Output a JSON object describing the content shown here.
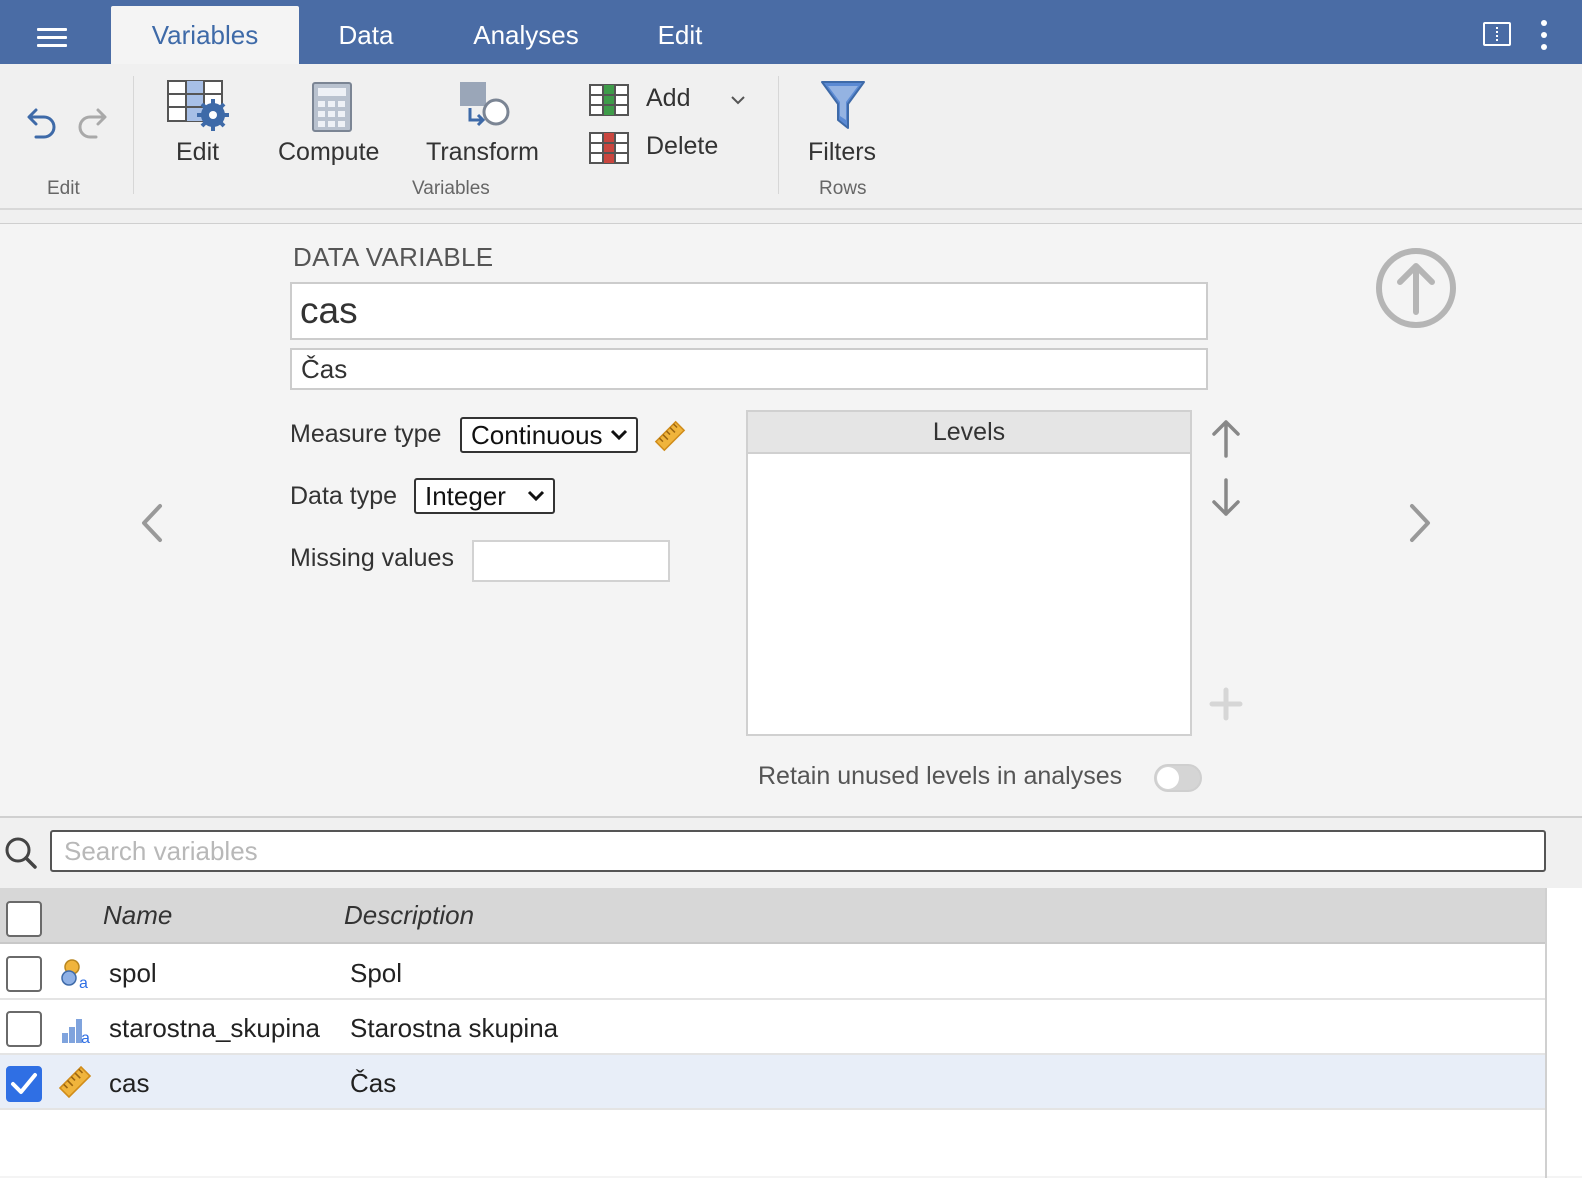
{
  "tabs": [
    "Variables",
    "Data",
    "Analyses",
    "Edit"
  ],
  "active_tab": "Variables",
  "ribbon": {
    "edit_group": "Edit",
    "variables_group": "Variables",
    "rows_group": "Rows",
    "edit_label": "Edit",
    "compute_label": "Compute",
    "transform_label": "Transform",
    "add_label": "Add",
    "delete_label": "Delete",
    "filters_label": "Filters"
  },
  "editor": {
    "section_title": "DATA VARIABLE",
    "name": "cas",
    "description": "Čas",
    "measure_type_label": "Measure type",
    "measure_type_value": "Continuous",
    "data_type_label": "Data type",
    "data_type_value": "Integer",
    "missing_values_label": "Missing values",
    "missing_values_value": "",
    "levels_header": "Levels",
    "retain_label": "Retain unused levels in analyses",
    "retain_enabled": false
  },
  "search": {
    "placeholder": "Search variables",
    "value": ""
  },
  "table": {
    "columns": [
      "Name",
      "Description"
    ],
    "rows": [
      {
        "name": "spol",
        "description": "Spol",
        "type_icon": "nominal-text-icon",
        "checked": false
      },
      {
        "name": "starostna_skupina",
        "description": "Starostna skupina",
        "type_icon": "ordinal-text-icon",
        "checked": false
      },
      {
        "name": "cas",
        "description": "Čas",
        "type_icon": "continuous-ruler-icon",
        "checked": true
      }
    ]
  },
  "colors": {
    "header_blue": "#4a6ca5",
    "accent": "#2f6fe4",
    "ruler": "#e0a32e"
  }
}
